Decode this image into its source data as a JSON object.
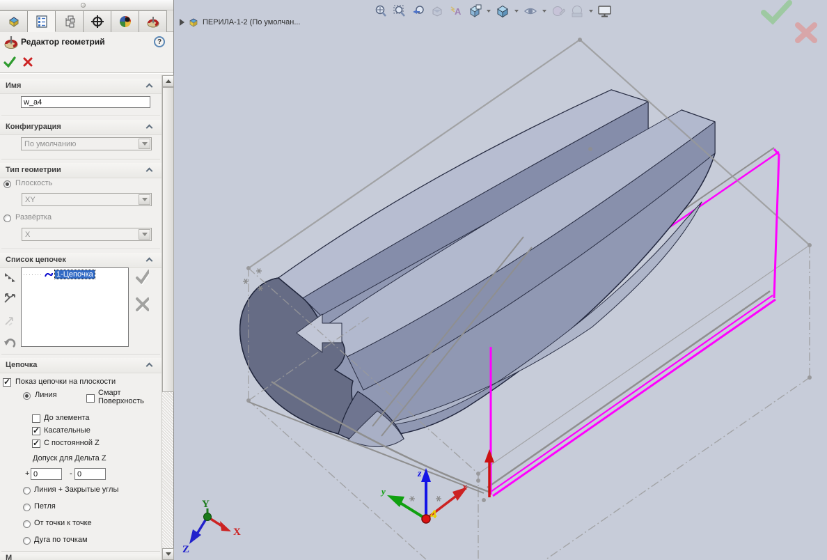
{
  "colors": {
    "magenta": "#ff00ff",
    "selection_blue": "#316ac5",
    "viewport_bg": "#c7ccd9",
    "box_gray": "#999999",
    "part_light": "#b7bdd1",
    "part_dark": "#666c85",
    "confirm_green": "#2e9b2e",
    "cancel_red": "#cc2222"
  },
  "panel": {
    "title": "Редактор геометрий",
    "help_label": "?",
    "sections": {
      "name": {
        "label": "Имя",
        "value": "w_a4"
      },
      "configuration": {
        "label": "Конфигурация",
        "value": "По умолчанию"
      },
      "geometry_type": {
        "label": "Тип геометрии",
        "plane_label": "Плоскость",
        "plane_value": "XY",
        "plane_selected": true,
        "unfold_label": "Развёртка",
        "unfold_value": "X",
        "unfold_selected": false
      },
      "chain_list": {
        "label": "Список цепочек",
        "items": [
          {
            "label": "1-Цепочка",
            "selected": true
          }
        ]
      },
      "chain": {
        "label": "Цепочка",
        "show_on_plane": {
          "label": "Показ цепочки на плоскости",
          "checked": true
        },
        "line_mode": {
          "label": "Линия",
          "selected": true
        },
        "smart_surface": {
          "label": "Смарт Поверхность",
          "checked": false
        },
        "to_element": {
          "label": "До элемента",
          "checked": false
        },
        "tangents": {
          "label": "Касательные",
          "checked": true
        },
        "constant_z": {
          "label": "С постоянной Z",
          "checked": true
        },
        "tolerance_label": "Допуск для Дельта Z",
        "plus_sign": "+",
        "minus_sign": "-",
        "plus_value": "0",
        "minus_value": "0",
        "radio_options": [
          {
            "label": "Линия + Закрытые углы",
            "selected": false
          },
          {
            "label": "Петля",
            "selected": false
          },
          {
            "label": "От точки к точке",
            "selected": false
          },
          {
            "label": "Дуга по точкам",
            "selected": false
          }
        ]
      },
      "partial_section": {
        "label": "М"
      }
    }
  },
  "viewport": {
    "feature_tree_item": "ПЕРИЛА-1-2  (По умолчан...",
    "origin_triad": {
      "x": "x",
      "y": "y",
      "z": "z",
      "name": "4"
    },
    "reference_triad": {
      "x": "X",
      "y": "Y",
      "z": "Z"
    }
  }
}
